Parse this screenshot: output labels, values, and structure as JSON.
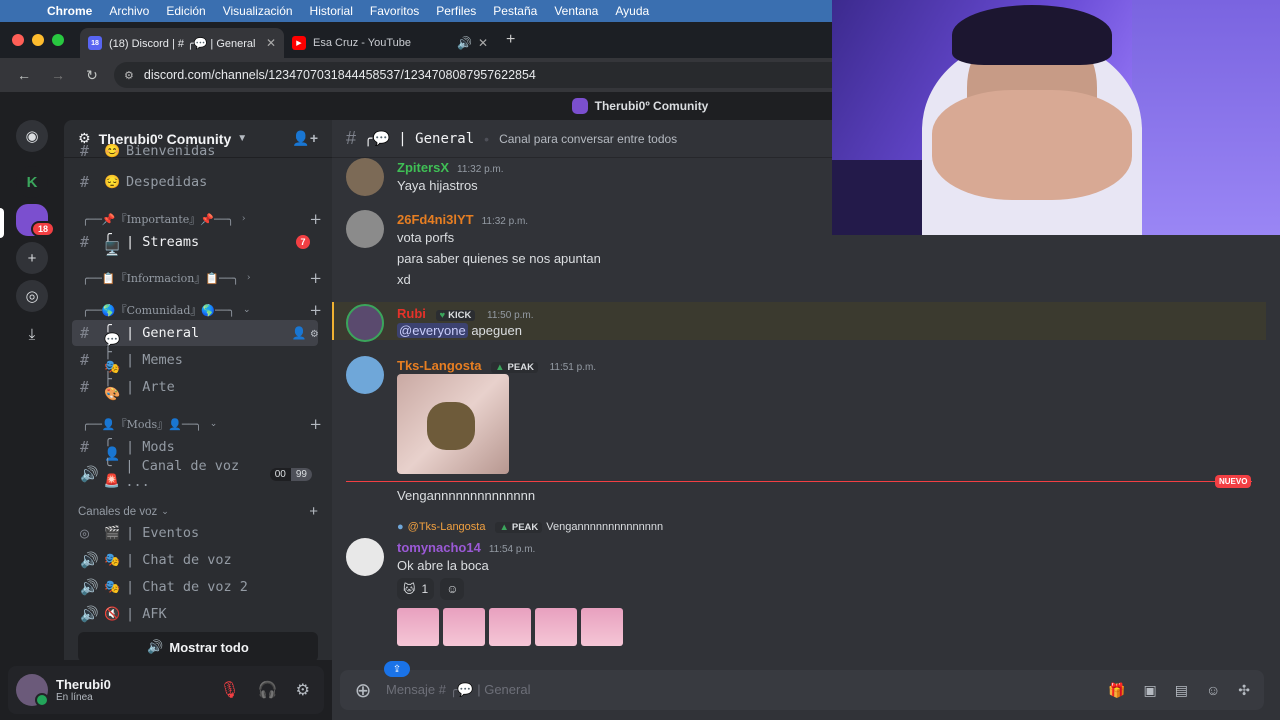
{
  "menubar": {
    "app": "Chrome",
    "items": [
      "Archivo",
      "Edición",
      "Visualización",
      "Historial",
      "Favoritos",
      "Perfiles",
      "Pestaña",
      "Ventana",
      "Ayuda"
    ]
  },
  "tabs": [
    {
      "title": "(18) Discord | # ╭💬 | General",
      "favicon": "18"
    },
    {
      "title": "Esa Cruz - YouTube"
    }
  ],
  "address": {
    "url": "discord.com/channels/1234707031844458537/1234708087957622854"
  },
  "window_title": "Therubi0º Comunity",
  "guild_rail": {
    "badge": "18"
  },
  "server": {
    "name": "Therubi0º Comunity"
  },
  "channels": [
    {
      "emoji": "😊",
      "name": "Bienvenidas"
    },
    {
      "emoji": "😔",
      "name": "Despedidas"
    },
    {
      "category": "╭──📌『Importante』📌──╮"
    },
    {
      "emoji": "╭🖥️",
      "name": "| Streams",
      "badge": "7"
    },
    {
      "category": "╭──📋『Informacion』📋──╮"
    },
    {
      "category": "╭──🌎『Comunidad』🌎──╮"
    },
    {
      "emoji": "╭💬",
      "name": "| General"
    },
    {
      "emoji": "├🎭",
      "name": "| Memes"
    },
    {
      "emoji": "├🎨",
      "name": "| Arte"
    },
    {
      "category": "╭──👤『Mods』👤──╮"
    },
    {
      "emoji": "╭👤",
      "name": "| Mods"
    },
    {
      "emoji": "╰🚨",
      "name": "| Canal de voz ...",
      "count_a": "00",
      "count_b": "99"
    }
  ],
  "voice_category": "Canales de voz",
  "voice_channels": [
    {
      "emoji": "🎬",
      "name": "| Eventos"
    },
    {
      "emoji": "🎭",
      "name": "| Chat de voz"
    },
    {
      "emoji": "🎭",
      "name": "| Chat de voz 2"
    },
    {
      "emoji": "🔇",
      "name": "| AFK"
    }
  ],
  "show_all": "Mostrar todo",
  "user": {
    "name": "Therubi0",
    "status": "En línea"
  },
  "chat_header": {
    "channel": "╭💬 | General",
    "topic": "Canal para conversar entre todos"
  },
  "messages": [
    {
      "author": "ZpitersX",
      "time": "11:32 p.m.",
      "lines": [
        "Yaya hijastros"
      ],
      "color": "#3fbf55"
    },
    {
      "author": "26Fd4ni3lYT",
      "time": "11:32 p.m.",
      "lines": [
        "vota porfs",
        "para saber quienes se nos apuntan",
        "xd"
      ],
      "color": "#e67e22"
    },
    {
      "author": "Rubi",
      "tag": "KICK",
      "time": "11:50 p.m.",
      "mention": "@everyone",
      "text": "apeguen",
      "color": "#e5322a"
    },
    {
      "author": "Tks-Langosta",
      "tag": "PEAK",
      "time": "11:51 p.m.",
      "color": "#e67e22",
      "after": "Vengannnnnnnnnnnnnn"
    },
    {
      "author": "tomynacho14",
      "time": "11:54 p.m.",
      "text": "Ok abre la boca",
      "color": "#9b59d6",
      "reply_author": "@Tks-Langosta",
      "reply_tag": "PEAK",
      "reply_text": "Vengannnnnnnnnnnnnn",
      "reaction_count": "1"
    }
  ],
  "new_marker": "NUEVO",
  "composer": {
    "placeholder": "Mensaje # ╭💬 | General"
  }
}
